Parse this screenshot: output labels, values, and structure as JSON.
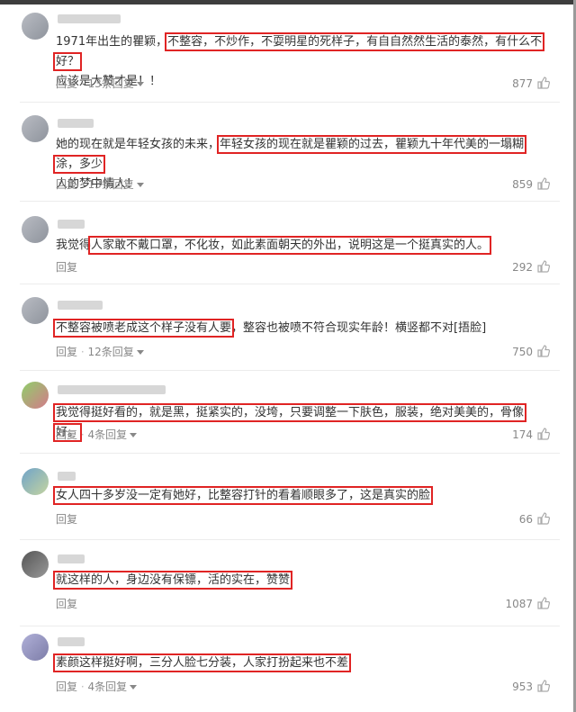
{
  "comments": [
    {
      "pre": "1971年出生的瞿颖，",
      "hl": "不整容，不炒作，不耍明星的死样子，有自自然然生活的泰然，有什么不好？",
      "post": "应该是大赞才是！！",
      "reply": "回复",
      "sub": "13条回复",
      "likes": "877"
    },
    {
      "pre": "她的现在就是年轻女孩的未来，",
      "hl": "年轻女孩的现在就是瞿颖的过去，瞿颖九十年代美的一塌糊涂，多少",
      "post": "人的梦中情人！",
      "reply": "回复",
      "sub": "13条回复",
      "likes": "859"
    },
    {
      "pre": "我觉得",
      "hl": "人家敢不戴口罩，不化妆，如此素面朝天的外出，说明这是一个挺真实的人。",
      "post": "",
      "reply": "回复",
      "sub": "",
      "likes": "292"
    },
    {
      "pre": "",
      "hl": "不整容被喷老成这个样子没有人要",
      "post": "，整容也被喷不符合现实年龄！横竖都不对[捂脸]",
      "reply": "回复",
      "sub": "12条回复",
      "likes": "750"
    },
    {
      "pre": "",
      "hl": "我觉得挺好看的，就是黑，挺紧实的，没垮，只要调整一下肤色，服装，绝对美美的，骨像好。",
      "post": "",
      "reply": "回复",
      "sub": "4条回复",
      "likes": "174"
    },
    {
      "pre": "",
      "hl": "女人四十多岁没一定有她好，比整容打针的看着顺眼多了，这是真实的脸",
      "post": "",
      "reply": "回复",
      "sub": "",
      "likes": "66"
    },
    {
      "pre": "",
      "hl": "就这样的人，身边没有保镖，活的实在，赞赞",
      "post": "",
      "reply": "回复",
      "sub": "",
      "likes": "1087"
    },
    {
      "pre": "",
      "hl": "素颜这样挺好啊，三分人脸七分装，人家打扮起来也不差",
      "post": "",
      "reply": "回复",
      "sub": "4条回复",
      "likes": "953"
    }
  ],
  "icons": {
    "reply_caret": "chevron-down-icon",
    "like": "thumbs-up-icon"
  },
  "colors": {
    "highlight_box": "#e02424",
    "meta_text": "#888888"
  }
}
